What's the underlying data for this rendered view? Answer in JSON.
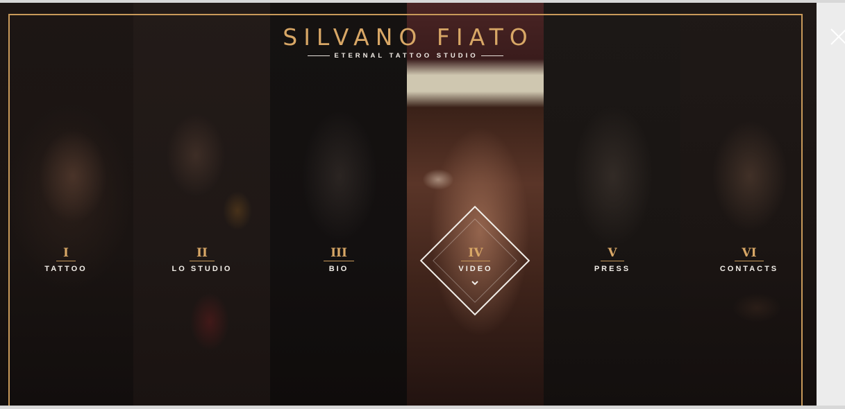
{
  "brand": {
    "title": "SILVANO FIATO",
    "subtitle": "ETERNAL TATTOO STUDIO"
  },
  "menu": [
    {
      "numeral": "I",
      "label": "TATTOO"
    },
    {
      "numeral": "II",
      "label": "LO STUDIO"
    },
    {
      "numeral": "III",
      "label": "BIO"
    },
    {
      "numeral": "IV",
      "label": "VIDEO"
    },
    {
      "numeral": "V",
      "label": "PRESS"
    },
    {
      "numeral": "VI",
      "label": "CONTACTS"
    }
  ],
  "active_index": 3,
  "icons": {
    "close": "close-icon",
    "active_indicator": "chevron-down-icon"
  },
  "colors": {
    "accent_gold": "#d8a766",
    "frame_gold": "#c99a5a",
    "text_light": "#f3efe9",
    "background": "#0f0d0c"
  }
}
